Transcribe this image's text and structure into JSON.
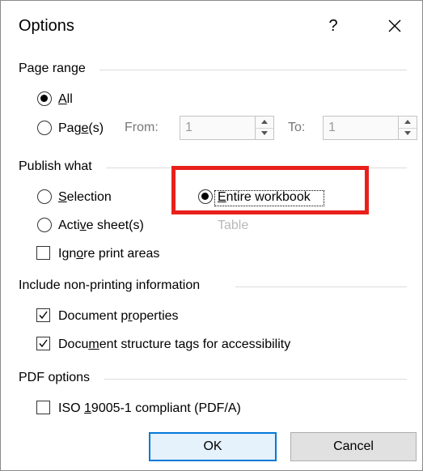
{
  "dialog": {
    "title": "Options",
    "help_label": "?",
    "close_label": "close"
  },
  "page_range": {
    "header": "Page range",
    "all": {
      "pre": "",
      "key": "A",
      "post": "ll",
      "selected": true
    },
    "pages": {
      "pre": "Pag",
      "key": "e",
      "post": "(s)",
      "selected": false
    },
    "from_label": "From:",
    "from_value": "1",
    "to_label": "To:",
    "to_value": "1"
  },
  "publish_what": {
    "header": "Publish what",
    "selection": {
      "pre": "",
      "key": "S",
      "post": "election",
      "selected": false
    },
    "entire_workbook": {
      "pre": "",
      "key": "E",
      "post": "ntire workbook",
      "selected": true
    },
    "active_sheets": {
      "pre": "Acti",
      "key": "v",
      "post": "e sheet(s)",
      "selected": false
    },
    "table_label": "Table",
    "ignore_print_areas": {
      "pre": "Ign",
      "key": "o",
      "post": "re print areas",
      "checked": false
    }
  },
  "non_printing": {
    "header": "Include non-printing information",
    "document_properties": {
      "pre": "Document p",
      "key": "r",
      "post": "operties",
      "checked": true
    },
    "structure_tags": {
      "pre": "Docu",
      "key": "m",
      "post": "ent structure tags for accessibility",
      "checked": true
    }
  },
  "pdf_options": {
    "header": "PDF options",
    "iso": {
      "pre": "ISO ",
      "key": "1",
      "post": "9005-1 compliant (PDF/A)",
      "checked": false
    }
  },
  "buttons": {
    "ok": "OK",
    "cancel": "Cancel"
  },
  "colors": {
    "highlight": "#e8201c",
    "accent": "#0078d7"
  }
}
